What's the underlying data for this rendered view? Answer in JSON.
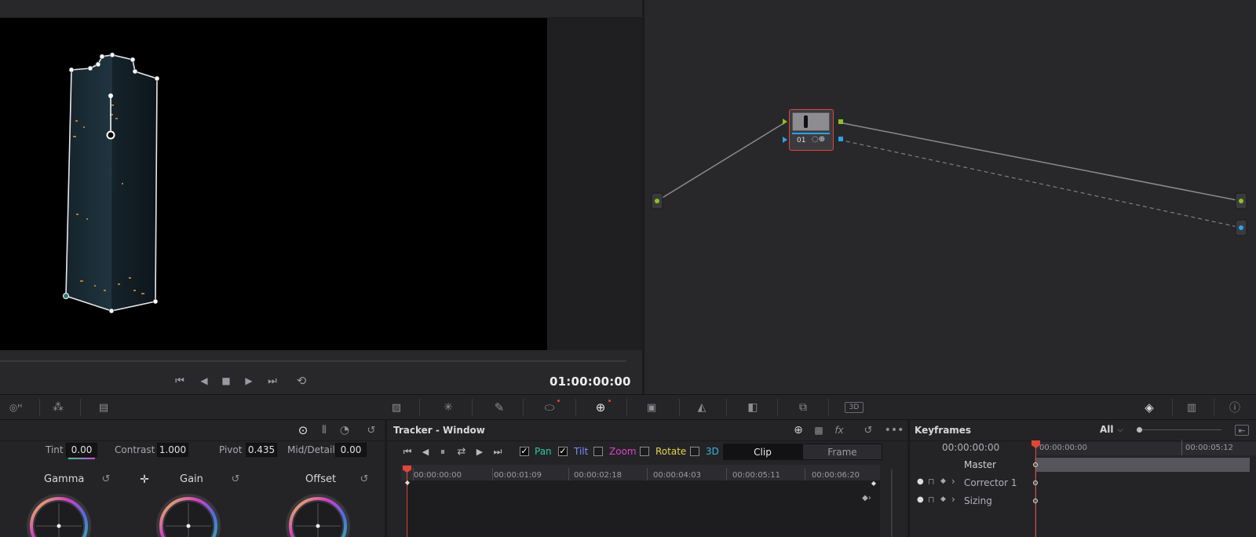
{
  "viewer": {
    "timecode": "01:00:00:00"
  },
  "color": {
    "params": [
      {
        "label": "Tint",
        "value": "0.00"
      },
      {
        "label": "Contrast",
        "value": "1.000"
      },
      {
        "label": "Pivot",
        "value": "0.435"
      },
      {
        "label": "Mid/Detail",
        "value": "0.00"
      }
    ],
    "wheels": [
      "Gamma",
      "Gain",
      "Offset"
    ]
  },
  "tracker": {
    "title": "Tracker - Window",
    "checks": [
      {
        "label": "Pan",
        "checked": true,
        "color": "#2fc7a0"
      },
      {
        "label": "Tilt",
        "checked": true,
        "color": "#7a8cff"
      },
      {
        "label": "Zoom",
        "checked": false,
        "color": "#d844c8"
      },
      {
        "label": "Rotate",
        "checked": false,
        "color": "#e4d34a"
      },
      {
        "label": "3D",
        "checked": false,
        "color": "#39b5e0"
      }
    ],
    "modes": {
      "clip": "Clip",
      "frame": "Frame"
    },
    "ticks": [
      "00:00:00:00",
      "00:00:01:09",
      "00:00:02:18",
      "00:00:04:03",
      "00:00:05:11",
      "00:00:06:20"
    ]
  },
  "keyframes": {
    "title": "Keyframes",
    "filter": "All",
    "timecode": "00:00:00:00",
    "ticks": [
      "00:00:00:00",
      "00:00:05:12"
    ],
    "rows": [
      "Master",
      "Corrector 1",
      "Sizing"
    ]
  },
  "node": {
    "label": "01"
  },
  "colors": {
    "accent_red": "#e0463a",
    "node_green": "#8bc320",
    "node_blue": "#2aa3e8"
  }
}
